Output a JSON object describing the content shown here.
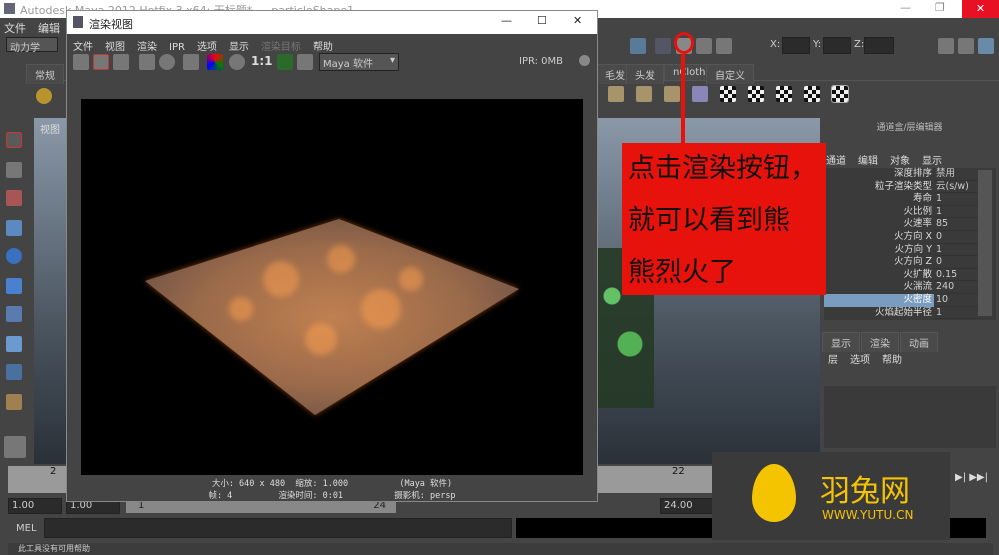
{
  "maya": {
    "title": "Autodesk Maya 2012 Hotfix 3 x64: 无标题*   ---   particleShape1",
    "menu": [
      "文件",
      "编辑"
    ],
    "mode": "动力学",
    "shelf_tabs": [
      "常规",
      "毛发",
      "头发",
      "nCloth",
      "自定义"
    ],
    "xyz": [
      "X:",
      "Y:",
      "Z:"
    ],
    "panel_menu": "视图"
  },
  "render_view": {
    "title": "渲染视图",
    "menu": [
      "文件",
      "视图",
      "渲染",
      "IPR",
      "选项",
      "显示",
      "渲染目标",
      "帮助"
    ],
    "ratio": "1:1",
    "renderer": "Maya 软件",
    "ipr": "IPR: 0MB",
    "status1": "大小: 640 x 480  缩放: 1.000          (Maya 软件)",
    "status2": "帧: 4         渲染时间: 0:01          摄影机: persp"
  },
  "channel_box": {
    "title": "通道盒/层编辑器",
    "menu": [
      "通道",
      "编辑",
      "对象",
      "显示"
    ],
    "rows": [
      {
        "l": "深度排序",
        "v": "禁用"
      },
      {
        "l": "粒子渲染类型",
        "v": "云(s/w)"
      },
      {
        "l": "寿命",
        "v": "1"
      },
      {
        "l": "火比例",
        "v": "1"
      },
      {
        "l": "火速率",
        "v": "85"
      },
      {
        "l": "火方向 X",
        "v": "0"
      },
      {
        "l": "火方向 Y",
        "v": "1"
      },
      {
        "l": "火方向 Z",
        "v": "0"
      },
      {
        "l": "火扩散",
        "v": "0.15"
      },
      {
        "l": "火湍流",
        "v": "240"
      },
      {
        "l": "火密度",
        "v": "10"
      },
      {
        "l": "火焰起始半径",
        "v": "1"
      }
    ],
    "selected": "火密度",
    "layer_tabs": [
      "显示",
      "渲染",
      "动画"
    ],
    "layer_menu": [
      "层",
      "选项",
      "帮助"
    ]
  },
  "timeline": {
    "ticks": [
      "2",
      "20",
      "22"
    ],
    "start": "1.00",
    "start2": "1.00",
    "range_start": "1",
    "range_end": "24",
    "end": "24.00"
  },
  "mel": {
    "label": "MEL"
  },
  "help_line": "此工具没有可用帮助",
  "annotation": {
    "lines": [
      "点击渲染按钮，",
      "就可以看到熊",
      "熊烈火了"
    ],
    "color": "#e8120c"
  },
  "watermark": {
    "name": "羽兔网",
    "url": "WWW.YUTU.CN",
    "color": "#f5c400"
  }
}
